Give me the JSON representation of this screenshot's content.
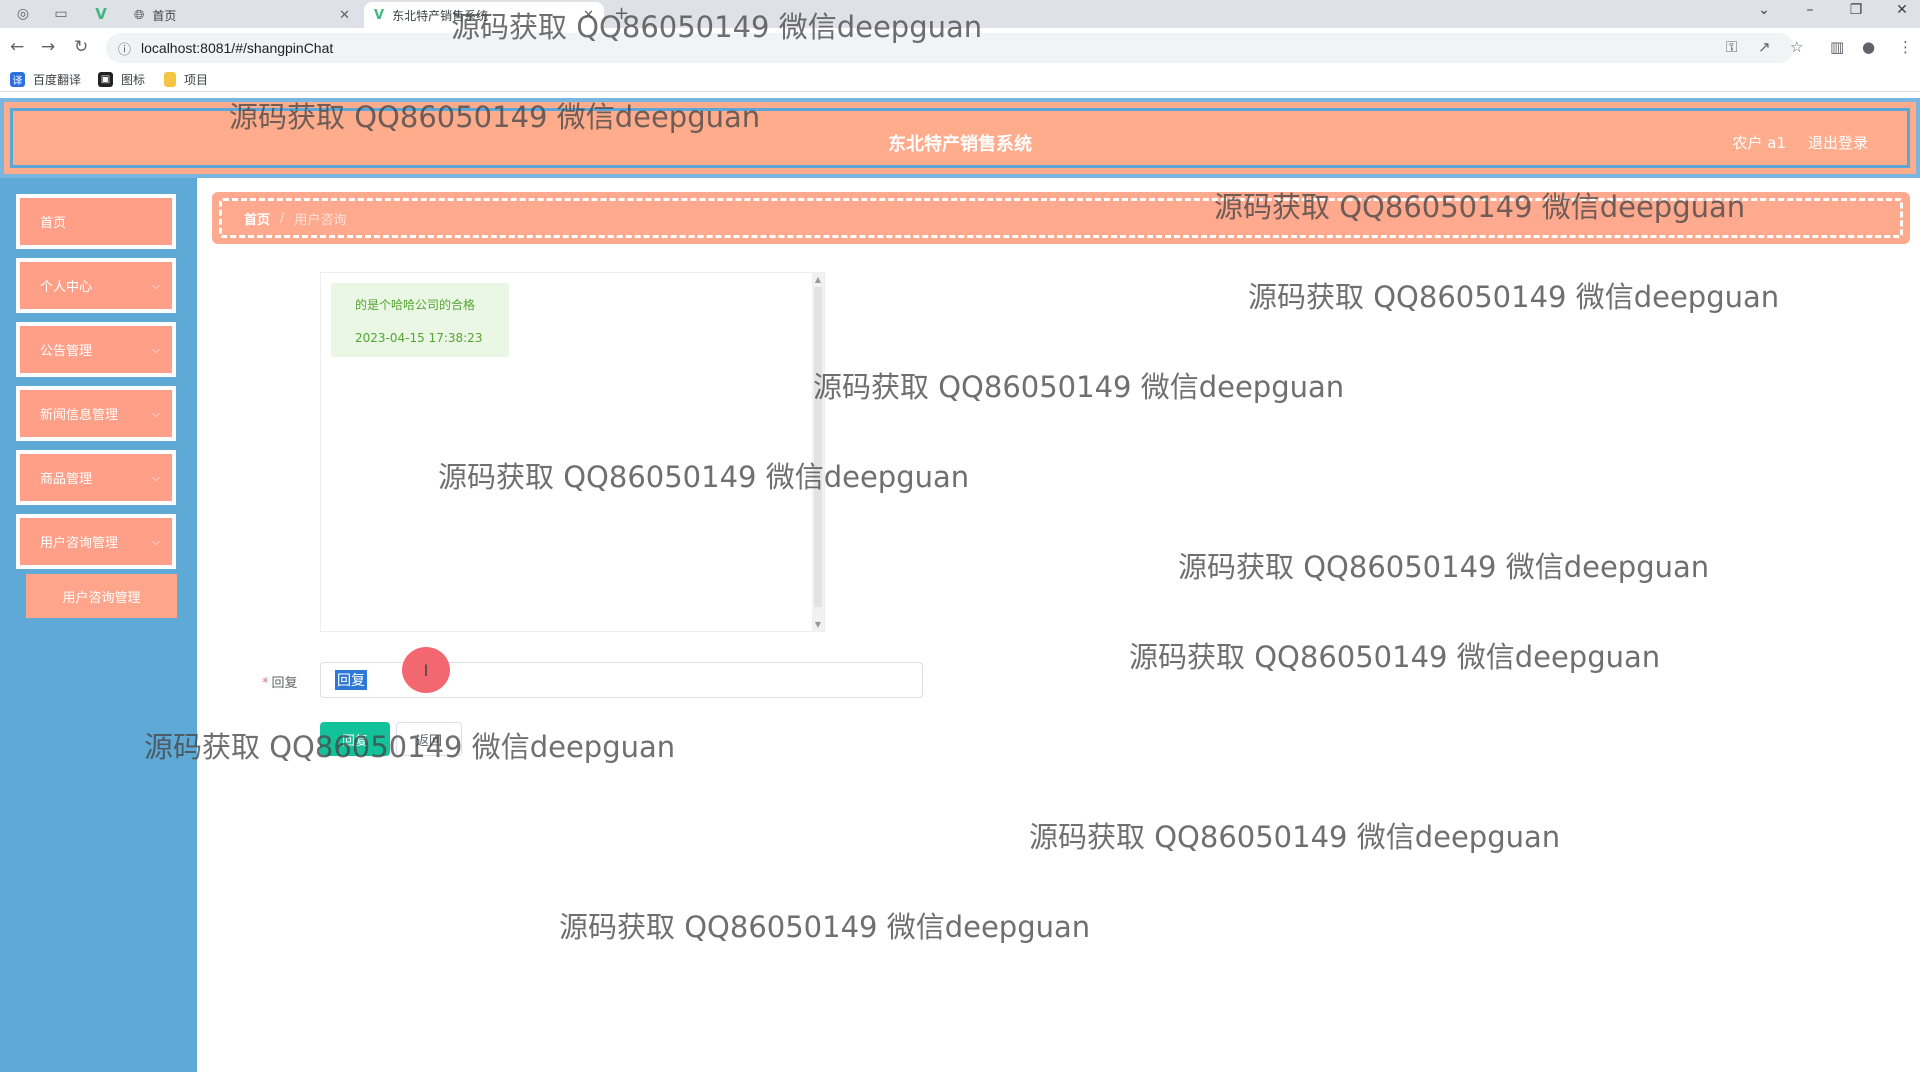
{
  "browser": {
    "tabs": [
      {
        "label": "首页",
        "icon": "globe-icon"
      },
      {
        "label": "东北特产销售系统",
        "icon": "vue-icon"
      }
    ],
    "url": "localhost:8081/#/shangpinChat",
    "bookmarks": [
      {
        "label": "百度翻译",
        "icon": "translate-icon",
        "color": "#2b6fe0"
      },
      {
        "label": "图标",
        "icon": "image-icon",
        "color": "#222222"
      },
      {
        "label": "项目",
        "icon": "folder-icon",
        "color": "#f4c542"
      }
    ]
  },
  "header": {
    "title": "东北特产销售系统",
    "user": "农户 a1",
    "logout": "退出登录"
  },
  "sidebar": {
    "items": [
      {
        "label": "首页",
        "has_chevron": false
      },
      {
        "label": "个人中心",
        "has_chevron": true
      },
      {
        "label": "公告管理",
        "has_chevron": true
      },
      {
        "label": "新闻信息管理",
        "has_chevron": true
      },
      {
        "label": "商品管理",
        "has_chevron": true
      },
      {
        "label": "用户咨询管理",
        "has_chevron": true
      }
    ],
    "sub_item": "用户咨询管理"
  },
  "breadcrumb": {
    "home": "首页",
    "separator": "/",
    "current": "用户咨询"
  },
  "chat": {
    "messages": [
      {
        "text": "的是个哈哈公司的合格",
        "time": "2023-04-15 17:38:23"
      }
    ]
  },
  "form": {
    "reply_label": "回复",
    "required_mark": "*",
    "reply_value": "回复",
    "submit_label": "回复",
    "back_label": "返回"
  },
  "watermark": "源码获取 QQ86050149 微信deepguan",
  "colors": {
    "header_bg": "#ffac8c",
    "sidebar_bg": "#5fa9d6",
    "menu_item_bg": "#ff9f87",
    "primary_button": "#13c29a",
    "chat_bubble_bg": "#e9f7e4",
    "chat_text": "#55a532"
  }
}
